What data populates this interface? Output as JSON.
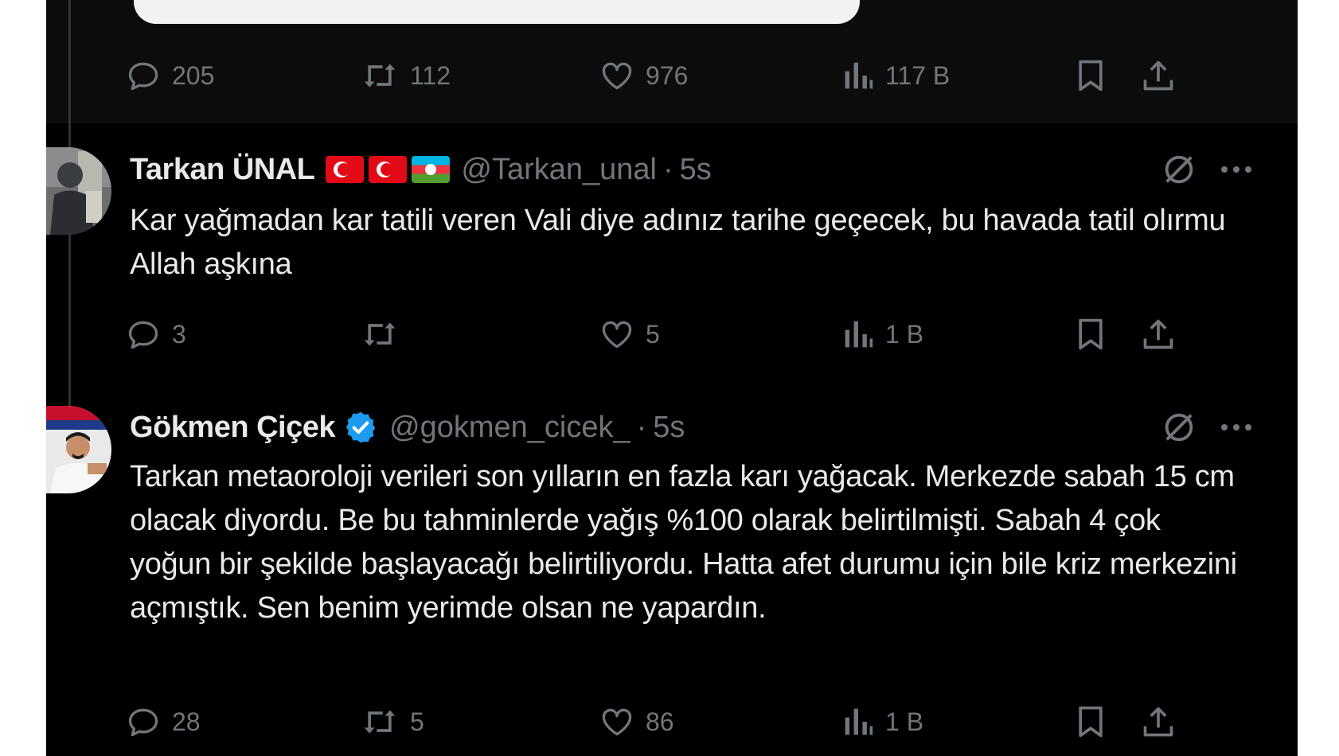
{
  "colors": {
    "background": "#000000",
    "text_primary": "#e7e9ea",
    "text_secondary": "#71767b",
    "verified_blue": "#1d9bf0"
  },
  "top_tweet": {
    "actions": {
      "replies": "205",
      "retweets": "112",
      "likes": "976",
      "views": "117 B"
    }
  },
  "tweets": [
    {
      "display_name": "Tarkan ÜNAL",
      "flags": [
        "turkey-flag",
        "turkey-flag",
        "azerbaijan-flag"
      ],
      "handle": "@Tarkan_unal",
      "dot": "·",
      "time": "5s",
      "text": "Kar yağmadan kar tatili veren Vali diye adınız tarihe geçecek, bu havada tatil olırmu Allah aşkına",
      "actions": {
        "replies": "3",
        "retweets": "",
        "likes": "5",
        "views": "1 B"
      }
    },
    {
      "display_name": "Gökmen Çiçek",
      "verified": true,
      "handle": "@gokmen_cicek_",
      "dot": "·",
      "time": "5s",
      "text": "Tarkan metaoroloji verileri son yılların en fazla karı yağacak. Merkezde sabah 15 cm olacak diyordu. Be bu tahminlerde yağış %100 olarak belirtilmişti. Sabah 4 çok yoğun bir şekilde başlayacağı belirtiliyordu. Hatta afet durumu için bile kriz merkezini açmıştık. Sen benim yerimde olsan ne yapardın.",
      "actions": {
        "replies": "28",
        "retweets": "5",
        "likes": "86",
        "views": "1 B"
      }
    }
  ]
}
